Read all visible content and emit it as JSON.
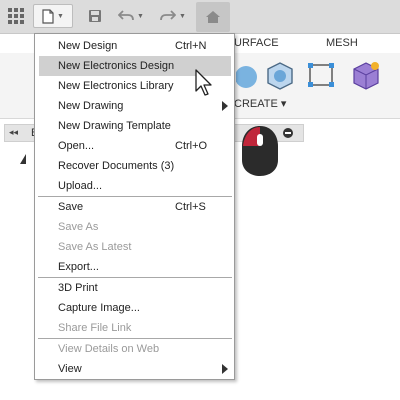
{
  "toolbar": {
    "icons": [
      "grid-icon",
      "file-icon",
      "save-icon",
      "undo-icon",
      "redo-icon",
      "home-icon"
    ]
  },
  "ribbon": {
    "tabs": [
      "URFACE",
      "MESH"
    ],
    "create_label": "CREATE ▾"
  },
  "browser": {
    "collapse_glyph": "◂◂",
    "label": "B"
  },
  "file_menu": {
    "items": [
      {
        "label": "New Design",
        "shortcut": "Ctrl+N"
      },
      {
        "label": "New Electronics Design",
        "shortcut": ""
      },
      {
        "label": "New Electronics Library",
        "shortcut": ""
      },
      {
        "label": "New Drawing",
        "shortcut": ""
      },
      {
        "label": "New Drawing Template",
        "shortcut": ""
      },
      {
        "label": "Open...",
        "shortcut": "Ctrl+O"
      },
      {
        "label": "Recover Documents (3)",
        "shortcut": ""
      },
      {
        "label": "Upload...",
        "shortcut": ""
      },
      {
        "label": "Save",
        "shortcut": "Ctrl+S"
      },
      {
        "label": "Save As",
        "shortcut": ""
      },
      {
        "label": "Save As Latest",
        "shortcut": ""
      },
      {
        "label": "Export...",
        "shortcut": ""
      },
      {
        "label": "3D Print",
        "shortcut": ""
      },
      {
        "label": "Capture Image...",
        "shortcut": ""
      },
      {
        "label": "Share File Link",
        "shortcut": ""
      },
      {
        "label": "View Details on Web",
        "shortcut": ""
      },
      {
        "label": "View",
        "shortcut": ""
      }
    ],
    "highlighted": "New Electronics Design",
    "disabled": [
      "Save As",
      "Save As Latest",
      "Share File Link",
      "View Details on Web"
    ],
    "with_submenu": [
      "New Drawing",
      "View"
    ]
  },
  "colors": {
    "toolbar_bg": "#dcdcdc",
    "menu_highlight": "#d0d0d0",
    "disabled_text": "#9a9a9a",
    "mouse_accent": "#c0263a"
  }
}
